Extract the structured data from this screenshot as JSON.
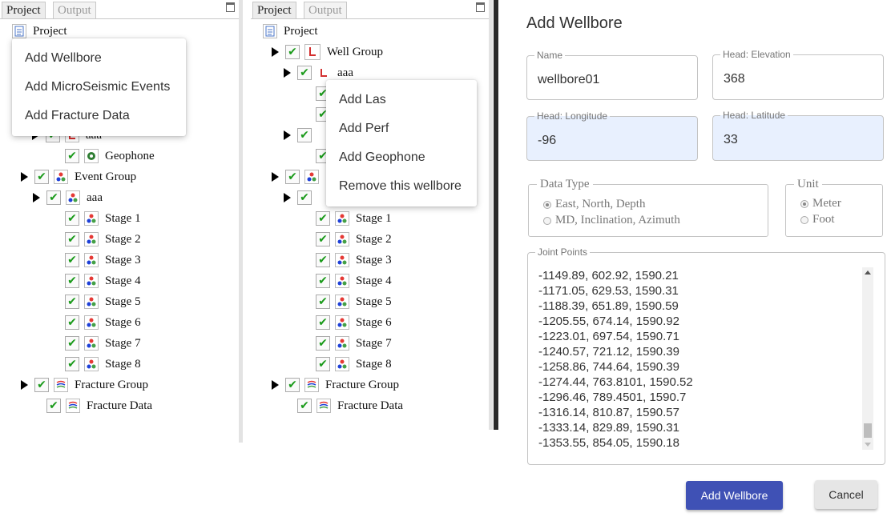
{
  "left_panel": {
    "tabs": [
      {
        "label": "Project"
      },
      {
        "label": "Output"
      }
    ],
    "root": {
      "label": "Project"
    },
    "context_menu": [
      {
        "label": "Add Wellbore"
      },
      {
        "label": "Add MicroSeismic Events"
      },
      {
        "label": "Add Fracture Data"
      }
    ],
    "partial_label": "aaa",
    "geophone": {
      "label": "Geophone"
    },
    "event_group": {
      "label": "Event Group"
    },
    "event_child": {
      "label": "aaa"
    },
    "stages": [
      {
        "label": "Stage 1"
      },
      {
        "label": "Stage 2"
      },
      {
        "label": "Stage 3"
      },
      {
        "label": "Stage 4"
      },
      {
        "label": "Stage 5"
      },
      {
        "label": "Stage 6"
      },
      {
        "label": "Stage 7"
      },
      {
        "label": "Stage 8"
      }
    ],
    "fracture_group": {
      "label": "Fracture Group"
    },
    "fracture_data": {
      "label": "Fracture Data"
    }
  },
  "middle_panel": {
    "tabs": [
      {
        "label": "Project"
      },
      {
        "label": "Output"
      }
    ],
    "root": {
      "label": "Project"
    },
    "well_group": {
      "label": "Well Group"
    },
    "well_child": {
      "label": "aaa"
    },
    "context_menu": [
      {
        "label": "Add Las"
      },
      {
        "label": "Add Perf"
      },
      {
        "label": "Add Geophone"
      },
      {
        "label": "Remove this wellbore"
      }
    ],
    "stages": [
      {
        "label": "Stage 1"
      },
      {
        "label": "Stage 2"
      },
      {
        "label": "Stage 3"
      },
      {
        "label": "Stage 4"
      },
      {
        "label": "Stage 5"
      },
      {
        "label": "Stage 6"
      },
      {
        "label": "Stage 7"
      },
      {
        "label": "Stage 8"
      }
    ],
    "fracture_group": {
      "label": "Fracture Group"
    },
    "fracture_data": {
      "label": "Fracture Data"
    }
  },
  "dialog": {
    "title": "Add Wellbore",
    "name": {
      "label": "Name",
      "value": "wellbore01"
    },
    "head_elevation": {
      "label": "Head: Elevation",
      "value": "368"
    },
    "head_longitude": {
      "label": "Head: Longitude",
      "value": "-96"
    },
    "head_latitude": {
      "label": "Head: Latitude",
      "value": "33"
    },
    "data_type": {
      "legend": "Data Type",
      "options": [
        "East, North, Depth",
        "MD, Inclination, Azimuth"
      ],
      "selected": "East, North, Depth"
    },
    "unit": {
      "legend": "Unit",
      "options": [
        "Meter",
        "Foot"
      ],
      "selected": "Meter"
    },
    "joint_points": {
      "label": "Joint Points",
      "lines": [
        "-1149.89, 602.92, 1590.21",
        "-1171.05, 629.53, 1590.31",
        "-1188.39, 651.89, 1590.59",
        "-1205.55, 674.14, 1590.92",
        "-1223.01, 697.54, 1590.71",
        "-1240.57, 721.12, 1590.39",
        "-1258.86, 744.64, 1590.39",
        "-1274.44, 763.8101, 1590.52",
        "-1296.46, 789.4501, 1590.7",
        "-1316.14, 810.87, 1590.57",
        "-1333.14, 829.89, 1590.31",
        "-1353.55, 854.05, 1590.18"
      ]
    },
    "add_button": "Add Wellbore",
    "cancel_button": "Cancel"
  },
  "colors": {
    "check": "#1a9a1a",
    "primary": "#3f51b5",
    "autofill": "#e8f0fe",
    "well_icon": "#d32f2f",
    "geophone_icon": "#2e7d32"
  }
}
